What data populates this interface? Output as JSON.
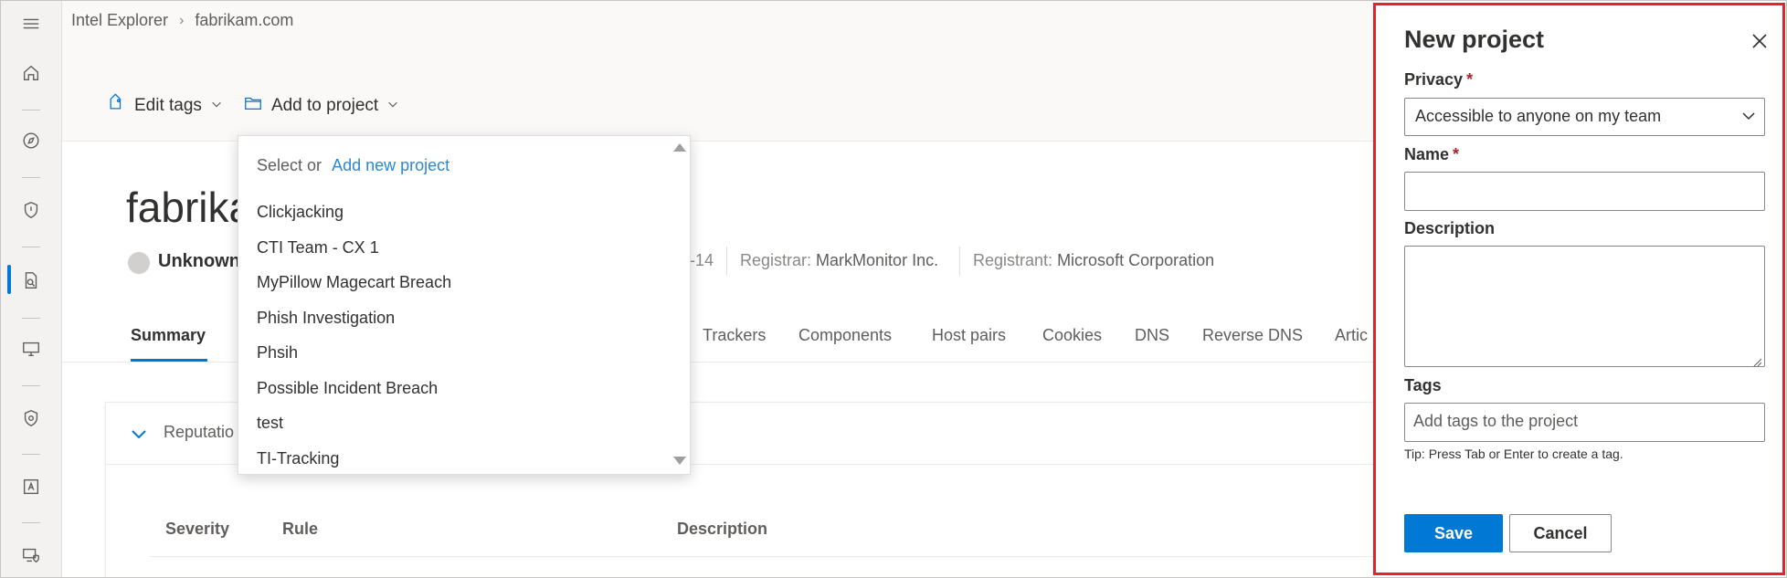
{
  "breadcrumb": {
    "root": "Intel Explorer",
    "current": "fabrikam.com"
  },
  "toolbar": {
    "edit_tags": "Edit tags",
    "add_to_project": "Add to project"
  },
  "entity": {
    "title_visible": "fabrika",
    "status_visible": "Unknown",
    "date_fragment": "-14",
    "registrar_label": "Registrar:",
    "registrar_value": "MarkMonitor Inc.",
    "registrant_label": "Registrant:",
    "registrant_value": "Microsoft Corporation"
  },
  "tabs": {
    "summary": "Summary",
    "trackers": "Trackers",
    "components": "Components",
    "host_pairs": "Host pairs",
    "cookies": "Cookies",
    "dns": "DNS",
    "reverse_dns": "Reverse DNS",
    "articles_visible": "Artic"
  },
  "card": {
    "title_visible": "Reputatio",
    "columns": {
      "severity": "Severity",
      "rule": "Rule",
      "description": "Description"
    }
  },
  "dropdown": {
    "prompt": "Select or",
    "add_link": "Add new project",
    "items": [
      "Clickjacking",
      "CTI Team - CX 1",
      "MyPillow Magecart Breach",
      "Phish Investigation",
      "Phsih",
      "Possible Incident Breach",
      "test",
      "TI-Tracking"
    ]
  },
  "panel": {
    "title": "New project",
    "privacy_label": "Privacy",
    "required_mark": "*",
    "privacy_value": "Accessible to anyone on my team",
    "name_label": "Name",
    "name_value": "",
    "description_label": "Description",
    "description_value": "",
    "tags_label": "Tags",
    "tags_placeholder": "Add tags to the project",
    "tip": "Tip: Press Tab or Enter to create a tag.",
    "save": "Save",
    "cancel": "Cancel"
  },
  "colors": {
    "accent": "#0078d4",
    "link": "#2b88d8",
    "highlight_border": "#e3242b",
    "required": "#a4262c"
  },
  "icons": {
    "rail": [
      "hamburger-icon",
      "home-icon",
      "compass-icon",
      "shield-icon",
      "document-search-icon",
      "monitor-icon",
      "shield-eye-icon",
      "contact-card-icon",
      "device-shield-icon"
    ],
    "toolbar": [
      "tag-icon",
      "folder-icon",
      "chevron-down-icon"
    ],
    "panel": [
      "close-icon",
      "chevron-down-icon"
    ]
  }
}
